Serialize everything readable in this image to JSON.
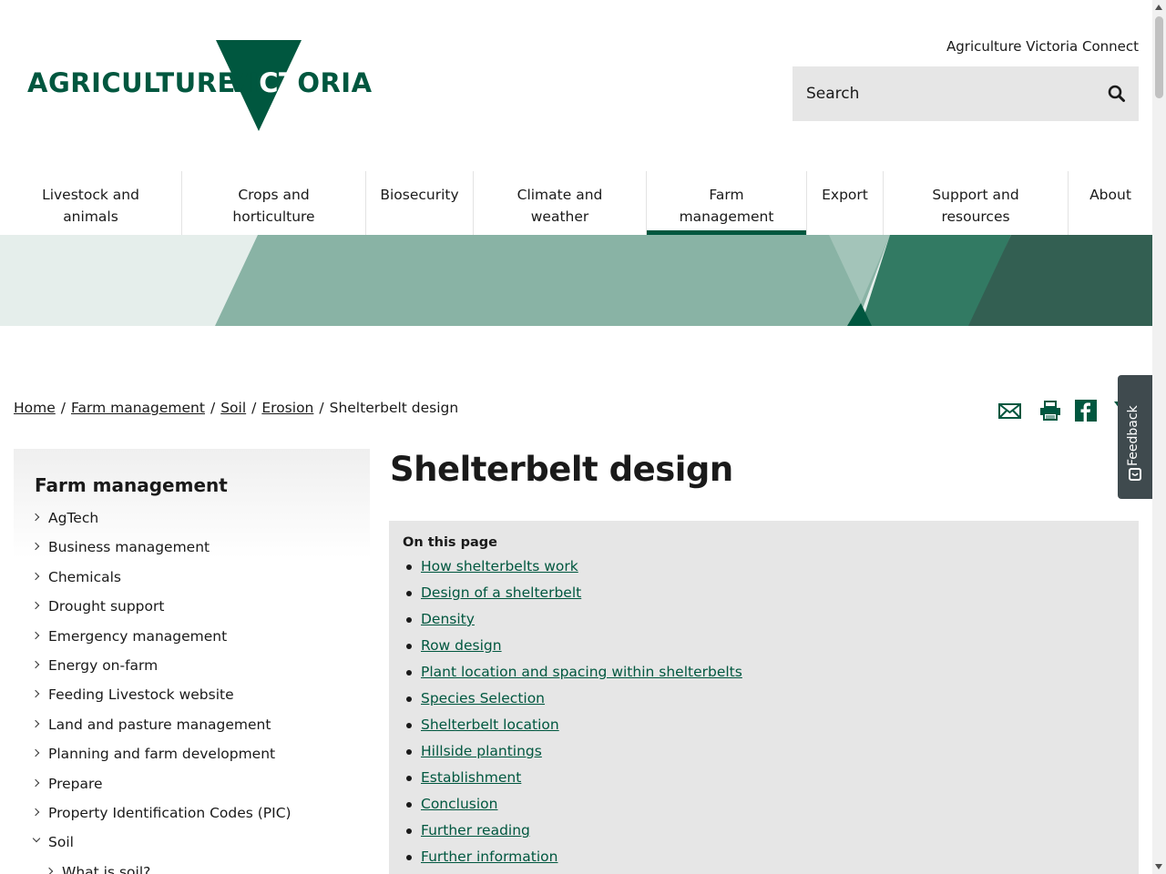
{
  "header": {
    "logo_part1": "AGRICULTURE",
    "logo_part2_a": "VI",
    "logo_part2_b": "CT",
    "logo_part2_c": "ORIA",
    "connect_link": "Agriculture Victoria Connect",
    "search_placeholder": "Search"
  },
  "nav": {
    "items": [
      {
        "label_line1": "Livestock and",
        "label_line2": "animals"
      },
      {
        "label_line1": "Crops and",
        "label_line2": "horticulture"
      },
      {
        "label_line1": "Biosecurity",
        "label_line2": ""
      },
      {
        "label_line1": "Climate and",
        "label_line2": "weather"
      },
      {
        "label_line1": "Farm",
        "label_line2": "management"
      },
      {
        "label_line1": "Export",
        "label_line2": ""
      },
      {
        "label_line1": "Support and",
        "label_line2": "resources"
      },
      {
        "label_line1": "About",
        "label_line2": ""
      }
    ],
    "active": "Farm management"
  },
  "breadcrumb": {
    "items": [
      "Home",
      "Farm management",
      "Soil",
      "Erosion"
    ],
    "current": "Shelterbelt design",
    "separator": "/"
  },
  "feedback": {
    "label": "Feedback"
  },
  "sidebar": {
    "title": "Farm management",
    "items": [
      "AgTech",
      "Business management",
      "Chemicals",
      "Drought support",
      "Emergency management",
      "Energy on-farm",
      "Feeding Livestock website",
      "Land and pasture management",
      "Planning and farm development",
      "Prepare",
      "Property Identification Codes (PIC)",
      "Soil",
      "What is soil?"
    ]
  },
  "content": {
    "title": "Shelterbelt design",
    "toc_heading": "On this page",
    "toc": [
      "How shelterbelts work",
      "Design of a shelterbelt",
      "Density",
      "Row design",
      "Plant location and spacing within shelterbelts",
      "Species Selection",
      "Shelterbelt location",
      "Hillside plantings",
      "Establishment",
      "Conclusion",
      "Further reading",
      "Further information"
    ]
  },
  "colors": {
    "brand_green": "#00573f",
    "panel_grey": "#e6e6e6"
  }
}
